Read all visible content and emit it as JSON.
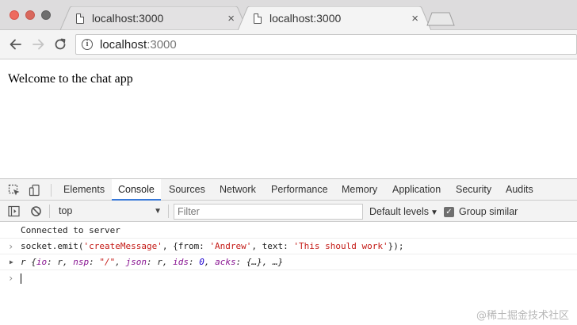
{
  "browser": {
    "tabs": [
      {
        "title": "localhost:3000",
        "active": false
      },
      {
        "title": "localhost:3000",
        "active": true
      }
    ],
    "close_glyph": "×",
    "url_host": "localhost",
    "url_port": ":3000"
  },
  "page": {
    "heading": "Welcome to the chat app"
  },
  "devtools": {
    "tabs": [
      "Elements",
      "Console",
      "Sources",
      "Network",
      "Performance",
      "Memory",
      "Application",
      "Security",
      "Audits"
    ],
    "active_tab": "Console",
    "context": "top",
    "filter_placeholder": "Filter",
    "levels": "Default levels",
    "group_similar": "Group similar",
    "group_similar_checked": true
  },
  "console": {
    "log_line": "Connected to server",
    "command": {
      "prefix": "socket.emit(",
      "arg1": "'createMessage'",
      "mid1": ", {from: ",
      "from": "'Andrew'",
      "mid2": ", text: ",
      "text": "'This should work'",
      "suffix": "});"
    },
    "result": {
      "name": "r ",
      "open": "{",
      "k1": "io",
      "v1": "r",
      "k2": "nsp",
      "v2": "\"/\"",
      "k3": "json",
      "v3": "r",
      "k4": "ids",
      "v4": "0",
      "k5": "acks",
      "v5": "{…}",
      "close": ", …}"
    }
  },
  "watermark": "@稀土掘金技术社区",
  "colors": {
    "active_tab_underline": "#3879d9",
    "string": "#c41a16",
    "key": "#881391",
    "number": "#1c00cf"
  }
}
